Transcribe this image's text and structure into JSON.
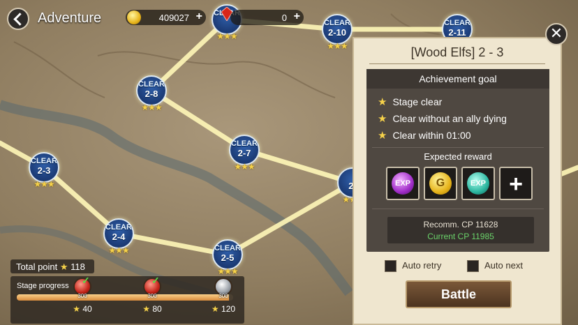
{
  "header": {
    "title": "Adventure",
    "gold_value": "409027",
    "gem_value": "0",
    "plus": "+"
  },
  "map": {
    "clear_label": "CLEAR",
    "stars": "★★★",
    "nodes": {
      "n23": "2-3",
      "n24": "2-4",
      "n25": "2-5",
      "n27": "2-7",
      "n28": "2-8",
      "n210": "2-10",
      "n211": "2-11",
      "n26p": "2-"
    }
  },
  "summary": {
    "total_label": "Total point",
    "total_value": "118",
    "progress_label": "Stage progress",
    "progress_fraction": 0.98,
    "milestones": [
      {
        "gem_value": "300",
        "stars": "40",
        "claimed": true
      },
      {
        "gem_value": "300",
        "stars": "80",
        "claimed": true
      },
      {
        "gem_value": "300",
        "stars": "120",
        "claimed": false
      }
    ]
  },
  "panel": {
    "title": "[Wood Elfs] 2 - 3",
    "achievement_header": "Achievement goal",
    "goals": [
      "Stage clear",
      "Clear without an ally dying",
      "Clear within 01:00"
    ],
    "reward_header": "Expected reward",
    "rewards": [
      {
        "icon": "exp-purple-icon",
        "label": "EXP"
      },
      {
        "icon": "gold-coin-icon",
        "label": "G"
      },
      {
        "icon": "exp-teal-icon",
        "label": "EXP"
      },
      {
        "icon": "plus-icon",
        "label": "+"
      }
    ],
    "recomm_cp": "Recomm. CP 11628",
    "current_cp": "Current CP 11985",
    "auto_retry": "Auto retry",
    "auto_next": "Auto next",
    "battle": "Battle",
    "close": "✕"
  },
  "colors": {
    "accent_gold": "#f6d24a",
    "current_cp_green": "#6ad26a",
    "panel_bg": "#efe6cf"
  }
}
